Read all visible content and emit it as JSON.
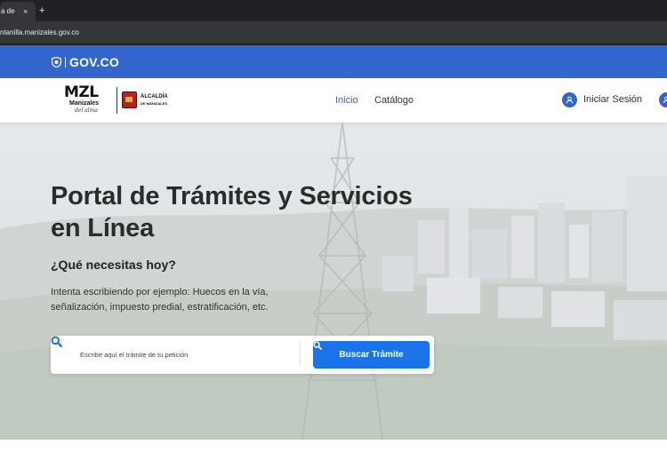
{
  "browser": {
    "tab_title": "a de",
    "tab_close": "×",
    "new_tab": "+",
    "url": "ntanilla.manizales.gov.co"
  },
  "govbar": {
    "logo_text": "GOV.CO",
    "color": "#3366cc"
  },
  "header": {
    "brand_main": "MZL",
    "brand_sub": "Manizales",
    "brand_tag": "del alma",
    "alcaldia_line1": "ALCALDÍA",
    "alcaldia_line2": "DE MANIZALES",
    "nav": [
      {
        "label": "Inicio",
        "active": true
      },
      {
        "label": "Catálogo",
        "active": false
      }
    ],
    "login_label": "Iniciar Sesión"
  },
  "hero": {
    "title": "Portal de Trámites y Servicios en Línea",
    "subtitle": "¿Qué necesitas hoy?",
    "description": "Intenta escribiendo por ejemplo: Huecos en la vía, señalización, impuesto predial, estratificación, etc.",
    "search": {
      "placeholder": "Escribe aquí el trámite de tu petición",
      "button_label": "Buscar Trámite",
      "button_color": "#1a73e8"
    }
  },
  "icons": [
    "shield-icon",
    "user-icon",
    "search-icon"
  ]
}
